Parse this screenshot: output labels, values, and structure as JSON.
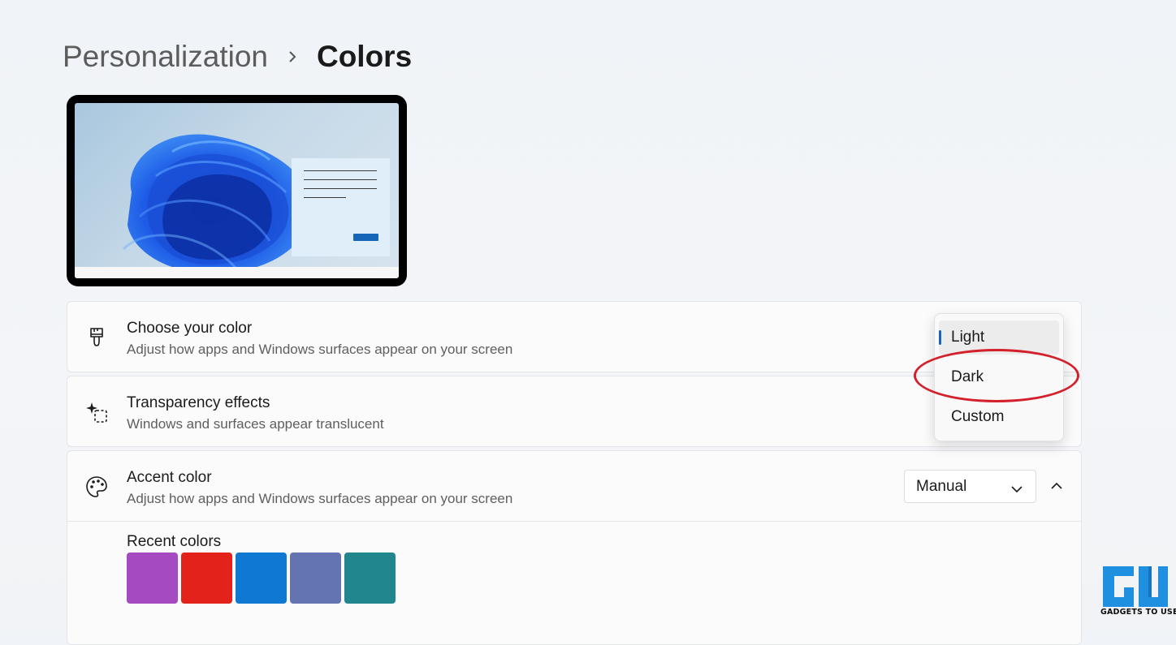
{
  "breadcrumb": {
    "parent": "Personalization",
    "current": "Colors"
  },
  "settings": {
    "choose_color": {
      "title": "Choose your color",
      "subtitle": "Adjust how apps and Windows surfaces appear on your screen",
      "icon": "paintbrush-icon"
    },
    "transparency": {
      "title": "Transparency effects",
      "subtitle": "Windows and surfaces appear translucent",
      "icon": "transparency-sparkle-icon"
    },
    "accent": {
      "title": "Accent color",
      "subtitle": "Adjust how apps and Windows surfaces appear on your screen",
      "icon": "palette-icon",
      "selected_option": "Manual",
      "recent_colors_label": "Recent colors",
      "recent_colors": [
        "#a64ac1",
        "#e3221c",
        "#0e78d3",
        "#6473b2",
        "#22868f"
      ]
    }
  },
  "dropdown": {
    "options": [
      "Light",
      "Dark",
      "Custom"
    ],
    "selected": "Light",
    "highlighted": "Dark"
  },
  "colors": {
    "accent": "#1566b8",
    "callout": "#d4202a",
    "logo": "#1f8fe0"
  },
  "watermark": {
    "text": "GADGETS TO USE"
  }
}
